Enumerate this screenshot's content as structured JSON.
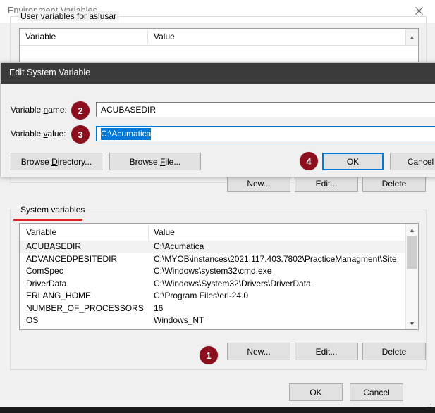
{
  "window": {
    "title": "Environment Variables",
    "close_icon": "close-icon",
    "ok_label": "OK",
    "cancel_label": "Cancel"
  },
  "user_section": {
    "legend": "User variables for aslusar",
    "columns": [
      "Variable",
      "Value"
    ],
    "buttons": {
      "new": "New...",
      "edit": "Edit...",
      "delete": "Delete"
    },
    "scroll_up_icon": "chevron-up-icon"
  },
  "system_section": {
    "legend": "System variables",
    "columns": [
      "Variable",
      "Value"
    ],
    "rows": [
      {
        "variable": "ACUBASEDIR",
        "value": "C:\\Acumatica",
        "selected": true
      },
      {
        "variable": "ADVANCEDPESITEDIR",
        "value": "C:\\MYOB\\instances\\2021.117.403.7802\\PracticeManagment\\Site",
        "selected": false
      },
      {
        "variable": "ComSpec",
        "value": "C:\\Windows\\system32\\cmd.exe",
        "selected": false
      },
      {
        "variable": "DriverData",
        "value": "C:\\Windows\\System32\\Drivers\\DriverData",
        "selected": false
      },
      {
        "variable": "ERLANG_HOME",
        "value": "C:\\Program Files\\erl-24.0",
        "selected": false
      },
      {
        "variable": "NUMBER_OF_PROCESSORS",
        "value": "16",
        "selected": false
      },
      {
        "variable": "OS",
        "value": "Windows_NT",
        "selected": false
      }
    ],
    "buttons": {
      "new": "New...",
      "edit": "Edit...",
      "delete": "Delete"
    },
    "scrollbar": {
      "up_icon": "chevron-up-icon",
      "down_icon": "chevron-down-icon"
    }
  },
  "dialog": {
    "title": "Edit System Variable",
    "name_label_pre": "Variable ",
    "name_label_mnemonic": "n",
    "name_label_post": "ame:",
    "value_label_pre": "Variable ",
    "value_label_mnemonic": "v",
    "value_label_post": "alue:",
    "name_value": "ACUBASEDIR",
    "value_value": "C:\\Acumatica",
    "value_selected": true,
    "browse_directory_pre": "Browse ",
    "browse_directory_mnemonic": "D",
    "browse_directory_post": "irectory...",
    "browse_file_pre": "Browse ",
    "browse_file_mnemonic": "F",
    "browse_file_post": "ile...",
    "ok_label": "OK",
    "cancel_label": "Cancel",
    "ok_focused": true
  },
  "annotations": {
    "badges": [
      {
        "id": "1",
        "label": "1"
      },
      {
        "id": "2",
        "label": "2"
      },
      {
        "id": "3",
        "label": "3"
      },
      {
        "id": "4",
        "label": "4"
      }
    ],
    "badge_color": "#8c0f1d",
    "underline_color": "#e8231f"
  },
  "colors": {
    "accent": "#0078d7",
    "dialog_titlebar": "#3b3b3b",
    "window_background": "#f0f0f0",
    "button_face": "#e1e1e1"
  }
}
